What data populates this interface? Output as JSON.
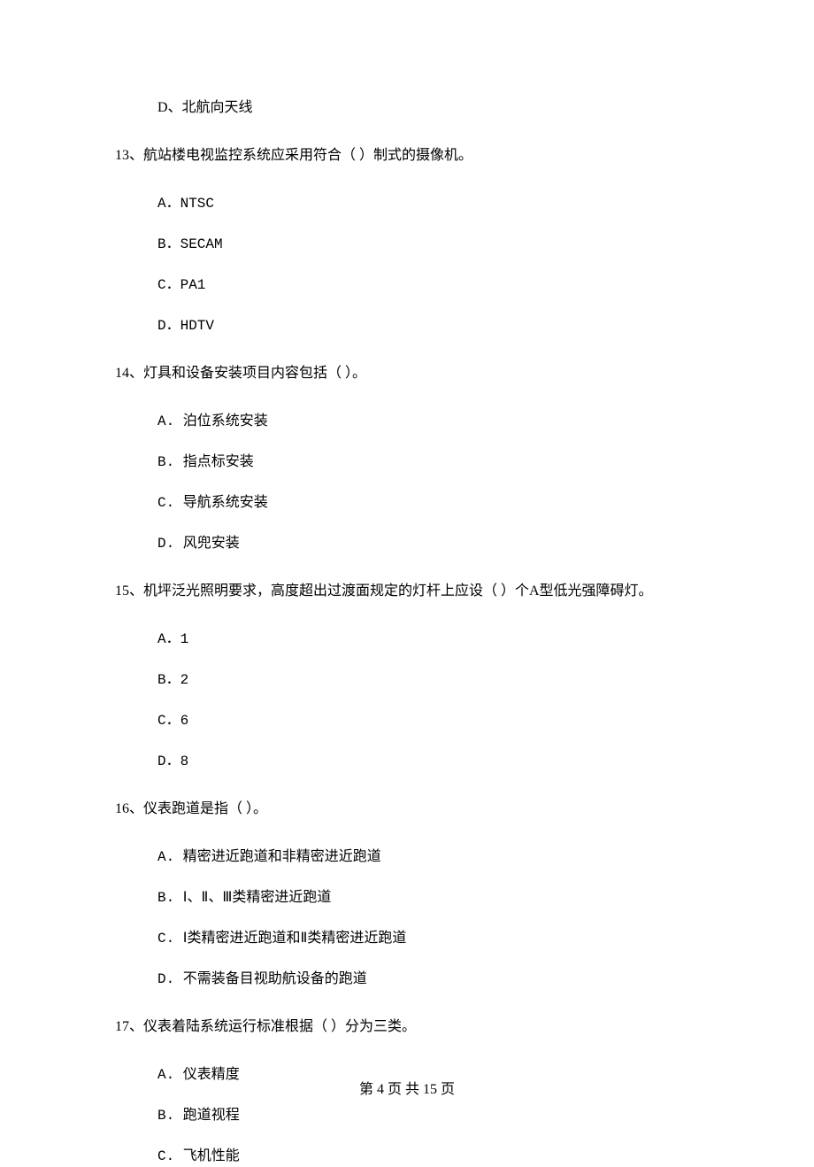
{
  "orphan_option": "D、北航向天线",
  "questions": [
    {
      "stem": "13、航站楼电视监控系统应采用符合（    ）制式的摄像机。",
      "options": [
        "A．NTSC",
        "B．SECAM",
        "C．PA1",
        "D．HDTV"
      ]
    },
    {
      "stem": "14、灯具和设备安装项目内容包括（    ）。",
      "options": [
        "A. 泊位系统安装",
        "B. 指点标安装",
        "C. 导航系统安装",
        "D. 风兜安装"
      ]
    },
    {
      "stem": "15、机坪泛光照明要求，高度超出过渡面规定的灯杆上应设（    ）个A型低光强障碍灯。",
      "options": [
        "A．1",
        "B．2",
        "C．6",
        "D．8"
      ]
    },
    {
      "stem": "16、仪表跑道是指（    ）。",
      "options": [
        "A. 精密进近跑道和非精密进近跑道",
        "B. Ⅰ、Ⅱ、Ⅲ类精密进近跑道",
        "C. Ⅰ类精密进近跑道和Ⅱ类精密进近跑道",
        "D. 不需装备目视助航设备的跑道"
      ]
    },
    {
      "stem": "17、仪表着陆系统运行标准根据（    ）分为三类。",
      "options": [
        "A. 仪表精度",
        "B. 跑道视程",
        "C. 飞机性能"
      ]
    }
  ],
  "footer": "第 4 页 共 15 页"
}
